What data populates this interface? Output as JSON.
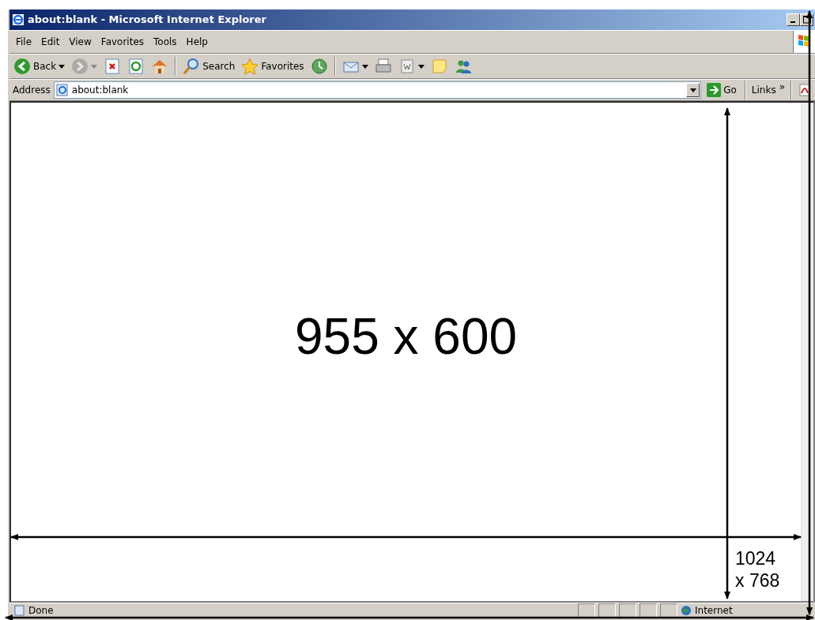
{
  "window": {
    "title": "about:blank - Microsoft Internet Explorer"
  },
  "menu": [
    {
      "label": "File"
    },
    {
      "label": "Edit"
    },
    {
      "label": "View"
    },
    {
      "label": "Favorites"
    },
    {
      "label": "Tools"
    },
    {
      "label": "Help"
    }
  ],
  "toolbar": [
    {
      "kind": "back",
      "label": "Back",
      "dropdown": true
    },
    {
      "kind": "forward",
      "dropdown": true,
      "disabled": true
    },
    {
      "kind": "stop"
    },
    {
      "kind": "refresh"
    },
    {
      "kind": "home"
    },
    {
      "kind": "separator"
    },
    {
      "kind": "search",
      "label": "Search"
    },
    {
      "kind": "favorites",
      "label": "Favorites"
    },
    {
      "kind": "history"
    },
    {
      "kind": "separator"
    },
    {
      "kind": "mail",
      "dropdown": true
    },
    {
      "kind": "print"
    },
    {
      "kind": "edit",
      "dropdown": true
    },
    {
      "kind": "note"
    },
    {
      "kind": "messenger"
    }
  ],
  "address_bar": {
    "label": "Address",
    "value": "about:blank",
    "go": "Go",
    "links": "Links",
    "chevron": "»"
  },
  "page": {
    "caption": "955 x 600"
  },
  "annotation": {
    "lines": [
      "1024",
      "x 768"
    ]
  },
  "status_bar": {
    "text": "Done",
    "zone": "Internet"
  }
}
